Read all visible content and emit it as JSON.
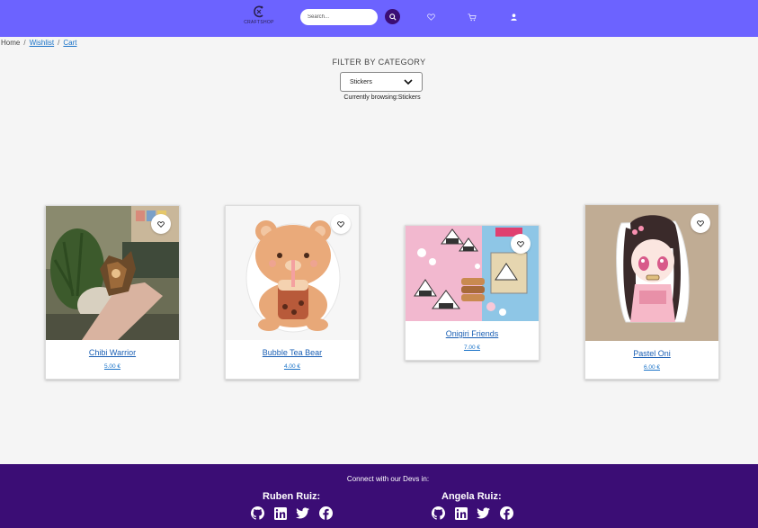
{
  "header": {
    "logo_text": "CRAFTSHOP",
    "search_placeholder": "Search...",
    "icons": [
      "search-icon",
      "heart-icon",
      "cart-icon",
      "user-icon"
    ]
  },
  "breadcrumb": {
    "home": "Home",
    "separator": "/",
    "wishlist": "Wishlist",
    "cart": "Cart"
  },
  "filter": {
    "title": "FILTER BY CATEGORY",
    "selected": "Stickers",
    "status_prefix": "Currently browsing:",
    "status_value": "Stickers"
  },
  "products": [
    {
      "name": "Chibi Warrior",
      "price": "5.00 €"
    },
    {
      "name": "Bubble Tea Bear",
      "price": "4.00 €"
    },
    {
      "name": "Onigiri Friends",
      "price": "7.00 €"
    },
    {
      "name": "Pastel Oni",
      "price": "6.00 €"
    }
  ],
  "footer": {
    "title": "Connect with our Devs in:",
    "devs": [
      {
        "name": "Ruben Ruiz:",
        "links": [
          "github-icon",
          "linkedin-icon",
          "twitter-icon",
          "facebook-icon"
        ]
      },
      {
        "name": "Angela Ruiz:",
        "links": [
          "github-icon",
          "linkedin-icon",
          "twitter-icon",
          "facebook-icon"
        ]
      }
    ]
  },
  "colors": {
    "header_bg": "#6c63ff",
    "footer_bg": "#3b0d75",
    "link": "#1a73c8",
    "page_bg": "#f5f5f5"
  }
}
